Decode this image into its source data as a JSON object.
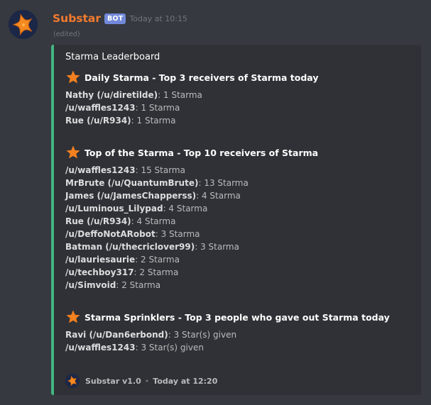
{
  "message": {
    "username": "Substar",
    "bot_tag": "BOT",
    "timestamp": "Today at 10:15",
    "edited": "(edited)",
    "avatar_icon": "starfish-avatar-icon"
  },
  "embed": {
    "accent_color": "#43b581",
    "title": "Starma Leaderboard",
    "sections": [
      {
        "icon": "star-icon",
        "title": "Daily Starma - Top 3 receivers of Starma today",
        "rows": [
          {
            "who": "Nathy (/u/diretilde)",
            "value": "1 Starma"
          },
          {
            "who": "/u/waffles1243",
            "value": "1 Starma"
          },
          {
            "who": "Rue (/u/R934)",
            "value": "1 Starma"
          }
        ]
      },
      {
        "icon": "star-icon",
        "title": "Top of the Starma - Top 10 receivers of Starma",
        "rows": [
          {
            "who": "/u/waffles1243",
            "value": "15 Starma"
          },
          {
            "who": "MrBrute (/u/QuantumBrute)",
            "value": "13 Starma"
          },
          {
            "who": "James (/u/JamesChapperss)",
            "value": "4 Starma"
          },
          {
            "who": "/u/Luminous_Lilypad",
            "value": "4 Starma"
          },
          {
            "who": "Rue (/u/R934)",
            "value": "4 Starma"
          },
          {
            "who": "/u/DeffoNotARobot",
            "value": "3 Starma"
          },
          {
            "who": "Batman (/u/thecriclover99)",
            "value": "3 Starma"
          },
          {
            "who": "/u/lauriesaurie",
            "value": "2 Starma"
          },
          {
            "who": "/u/techboy317",
            "value": "2 Starma"
          },
          {
            "who": "/u/Simvoid",
            "value": "2 Starma"
          }
        ]
      },
      {
        "icon": "star-icon",
        "title": "Starma Sprinklers - Top 3 people who gave out Starma today",
        "rows": [
          {
            "who": "Ravi (/u/Dan6erbond)",
            "value": "3 Star(s) given"
          },
          {
            "who": "/u/waffles1243",
            "value": "3 Star(s) given"
          }
        ]
      }
    ],
    "footer": {
      "text": "Substar v1.0",
      "separator": "•",
      "timestamp": "Today at 12:20"
    }
  }
}
